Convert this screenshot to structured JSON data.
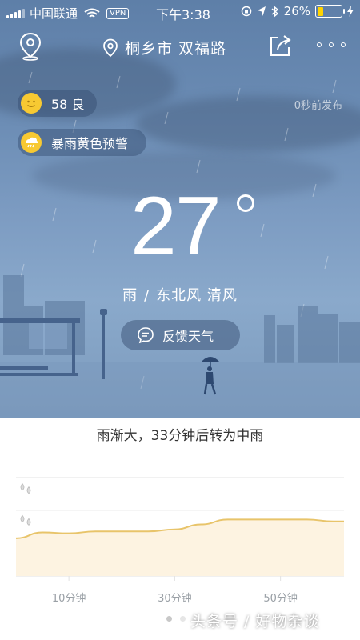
{
  "status_bar": {
    "carrier": "中国联通",
    "vpn": "VPN",
    "time": "下午3:38",
    "battery": "26%",
    "battery_level": 0.26
  },
  "header": {
    "location": "桐乡市 双福路"
  },
  "aqi": {
    "text": "58 良"
  },
  "warning": {
    "text": "暴雨黄色预警"
  },
  "publish_time": "0秒前发布",
  "current": {
    "temperature": "27",
    "weather": "雨",
    "separator": "/",
    "wind": "东北风 清风"
  },
  "feedback_label": "反馈天气",
  "forecast_summary": "雨渐大，33分钟后转为中雨",
  "colors": {
    "sky_top": "#5e7fa8",
    "accent_yellow": "#f7c932",
    "chart_line": "#e8c46a",
    "chart_fill": "#fdf3e1"
  },
  "chart_data": {
    "type": "area",
    "x": [
      0,
      5,
      10,
      15,
      20,
      25,
      30,
      35,
      40,
      45,
      50,
      55,
      60
    ],
    "values": [
      0.38,
      0.44,
      0.43,
      0.45,
      0.45,
      0.45,
      0.47,
      0.52,
      0.57,
      0.57,
      0.57,
      0.57,
      0.55
    ],
    "xlabel": "",
    "ylabel": "",
    "tick_labels": [
      "10分钟",
      "30分钟",
      "50分钟"
    ],
    "tick_positions": [
      10,
      30,
      50
    ],
    "xlim": [
      0,
      62
    ],
    "ylim": [
      0,
      1
    ],
    "y_levels": [
      "heavy-rain-icon",
      "moderate-rain-icon",
      "light-rain-icon"
    ]
  },
  "pager": {
    "count": 2,
    "active": 1
  },
  "watermark": "头条号 / 好物杂谈"
}
